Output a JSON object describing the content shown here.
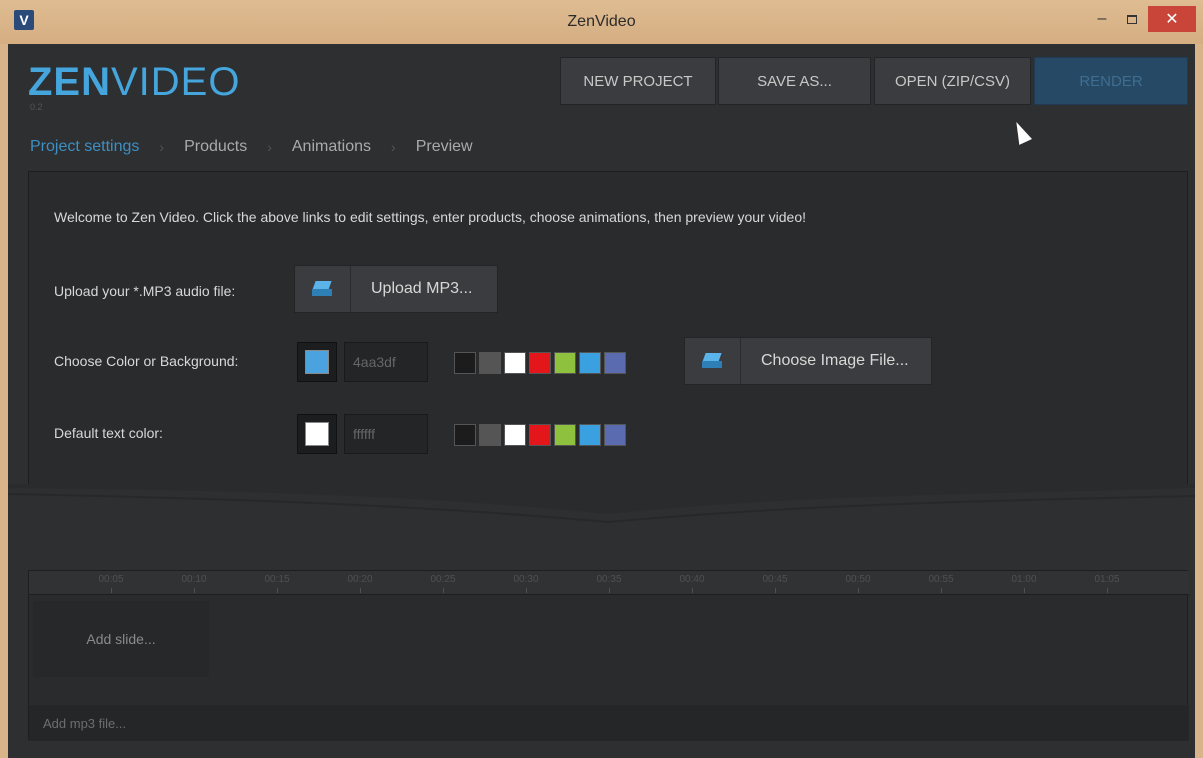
{
  "window": {
    "app_icon": "V",
    "title": "ZenVideo",
    "controls": {
      "minimize": "–",
      "maximize": "",
      "close": "✕"
    }
  },
  "logo": {
    "zen": "ZEN",
    "video": "VIDEO",
    "version": "0.2"
  },
  "toolbar": {
    "new_project": "NEW PROJECT",
    "save_as": "SAVE AS...",
    "open": "OPEN (ZIP/CSV)",
    "render": "RENDER"
  },
  "breadcrumb": {
    "items": [
      "Project settings",
      "Products",
      "Animations",
      "Preview"
    ],
    "separator": "›",
    "active_index": 0
  },
  "settings": {
    "welcome": "Welcome to Zen Video. Click the above links to edit settings, enter products, choose animations, then preview your video!",
    "audio_label": "Upload your *.MP3 audio file:",
    "upload_mp3": "Upload MP3...",
    "background_label": "Choose Color or Background:",
    "background_hex": "4aa3df",
    "background_color": "#4aa3df",
    "choose_image": "Choose Image File...",
    "text_color_label": "Default text color:",
    "text_hex": "ffffff",
    "text_color": "#ffffff",
    "palette": [
      "#1c1c1c",
      "#555555",
      "#ffffff",
      "#e3161b",
      "#8ec23e",
      "#3aa0e0",
      "#5b6bb0"
    ]
  },
  "timeline": {
    "ticks": [
      "00:05",
      "00:10",
      "00:15",
      "00:20",
      "00:25",
      "00:30",
      "00:35",
      "00:40",
      "00:45",
      "00:50",
      "00:55",
      "01:00",
      "01:05"
    ],
    "add_slide": "Add slide...",
    "add_mp3": "Add mp3 file..."
  },
  "colors": {
    "accent": "#45a6de",
    "render_button": "#264a66",
    "window_frame": "#d9b48a",
    "app_background": "#2e2f31"
  }
}
